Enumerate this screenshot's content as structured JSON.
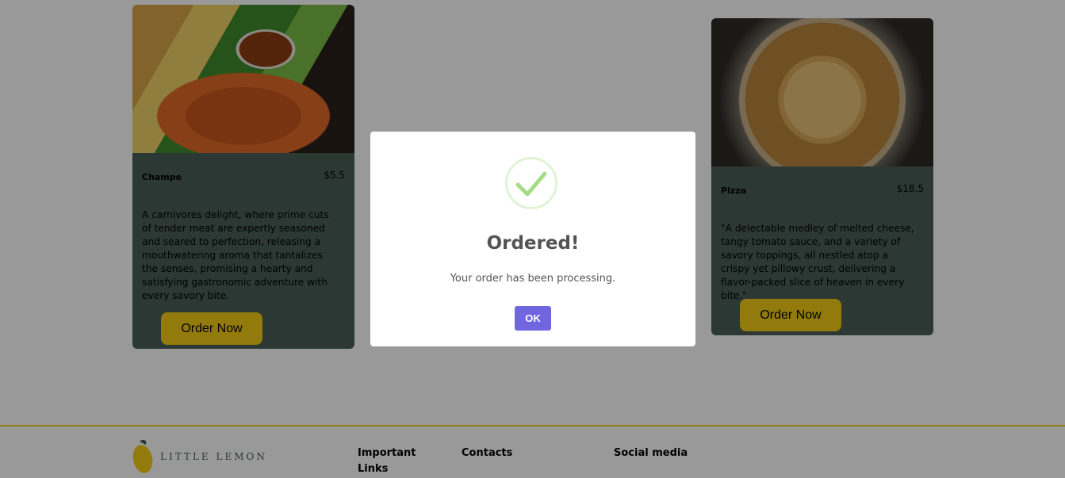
{
  "cards": [
    {
      "title": "Champe",
      "price": "$5.5",
      "description": "A carnivores delight, where prime cuts of tender meat are expertly seasoned and seared to perfection, releasing a mouthwatering aroma that tantalizes the senses, promising a hearty and satisfying gastronomic adventure with every savory bite.",
      "button_label": "Order Now",
      "image": "shrimp-fries-plate"
    },
    {
      "title": "Pizza",
      "price": "$18.5",
      "description": "\"A delectable medley of melted cheese, tangy tomato sauce, and a variety of savory toppings, all nestled atop a crispy yet pillowy crust, delivering a flavor-packed slice of heaven in every bite.\"",
      "button_label": "Order Now",
      "image": "pizza"
    }
  ],
  "footer": {
    "logo_text": "LITTLE LEMON",
    "logo_icon": "lemon-icon",
    "columns": [
      "Important Links",
      "Contacts",
      "Social media"
    ]
  },
  "modal": {
    "icon": "checkmark-icon",
    "title": "Ordered!",
    "message": "Your order has been processing.",
    "ok_label": "OK"
  },
  "colors": {
    "card_bg": "#495e57",
    "accent_yellow": "#f4ce14",
    "ok_button": "#7066e0",
    "check_green": "#a5dc86"
  }
}
